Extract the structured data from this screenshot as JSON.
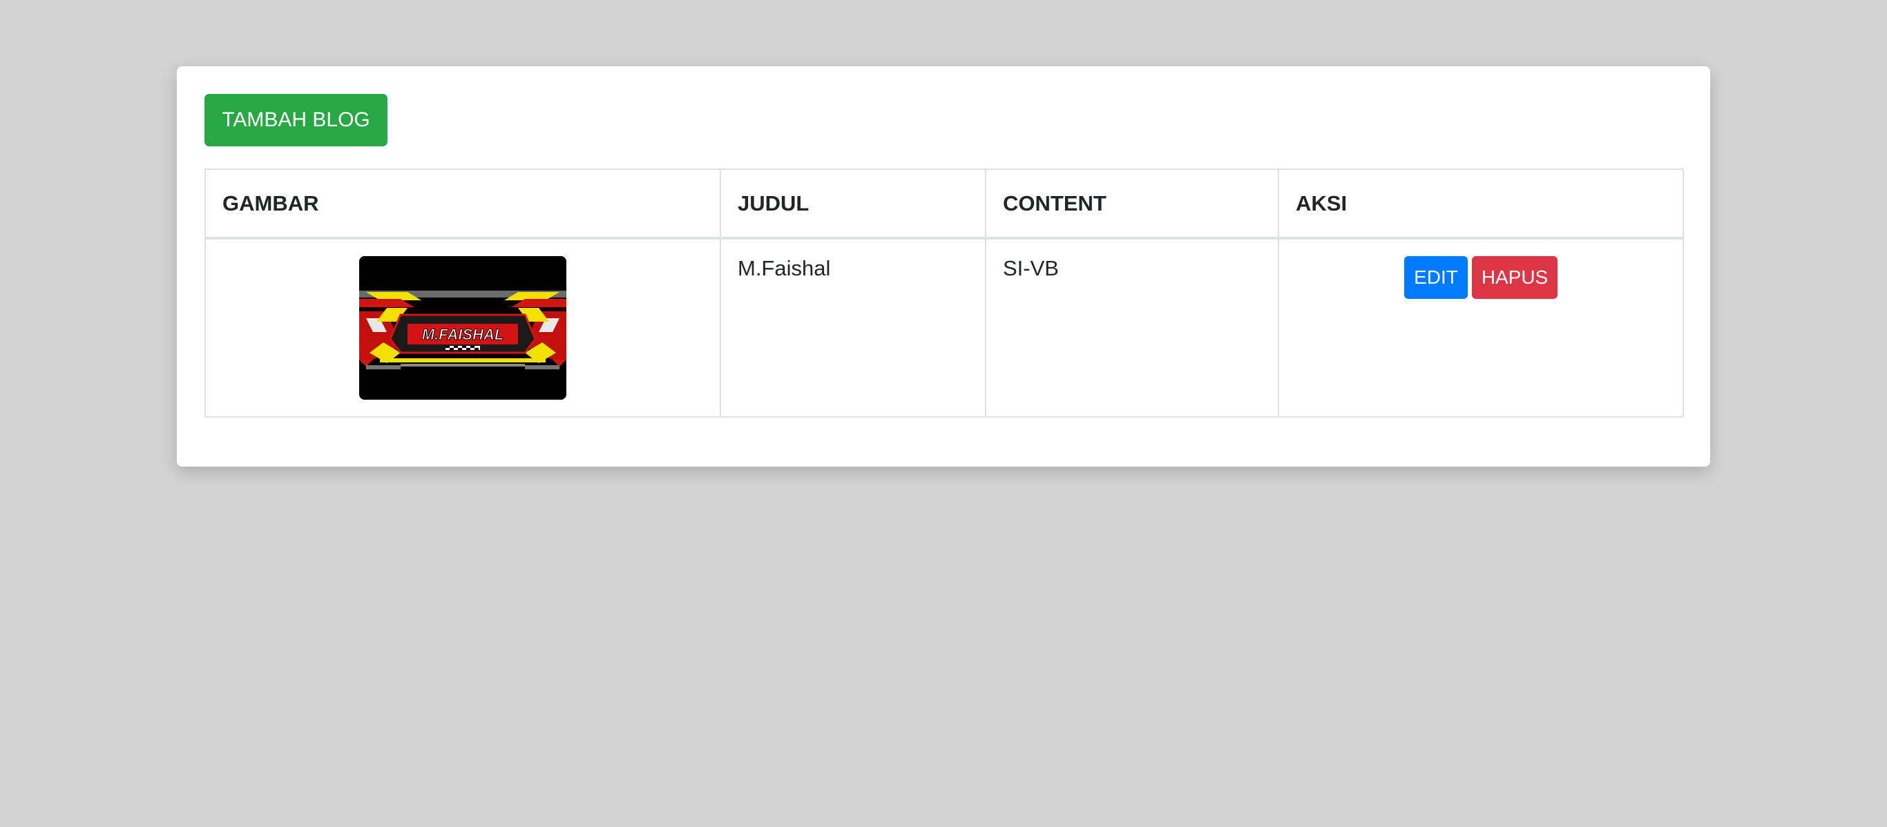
{
  "toolbar": {
    "add_label": "TAMBAH BLOG"
  },
  "table": {
    "headers": [
      "GAMBAR",
      "JUDUL",
      "CONTENT",
      "AKSI"
    ],
    "rows": [
      {
        "image_logo_text": "M.FAISHAL",
        "judul": "M.Faishal",
        "content": "SI-VB",
        "edit_label": "EDIT",
        "delete_label": "HAPUS"
      }
    ]
  },
  "colors": {
    "background": "#d3d3d3",
    "add_button": "#28a745",
    "edit_button": "#007bff",
    "delete_button": "#dc3545"
  }
}
